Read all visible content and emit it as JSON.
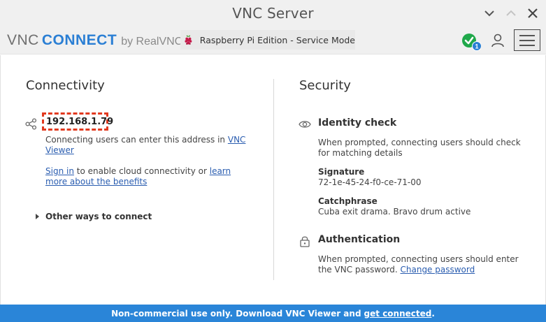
{
  "window": {
    "title": "VNC Server"
  },
  "header": {
    "logo_vnc": "VNC",
    "logo_connect": "CONNECT",
    "logo_by": "by RealVNC",
    "edition": "Raspberry Pi Edition - Service Mode",
    "status_badge_count": "1"
  },
  "connectivity": {
    "title": "Connectivity",
    "ip_address": "192.168.1.79",
    "address_text": "Connecting users can enter this address in ",
    "vnc_viewer_link": "VNC Viewer",
    "signin_link": "Sign in",
    "signin_text": " to enable cloud connectivity or ",
    "learn_more_link": "learn more about the benefits",
    "other_ways": "Other ways to connect"
  },
  "security": {
    "title": "Security",
    "identity_check": {
      "title": "Identity check",
      "description": "When prompted, connecting users should check for matching details",
      "signature_label": "Signature",
      "signature_value": "72-1e-45-24-f0-ce-71-00",
      "catchphrase_label": "Catchphrase",
      "catchphrase_value": "Cuba exit drama. Bravo drum active"
    },
    "authentication": {
      "title": "Authentication",
      "description": "When prompted, connecting users should enter the VNC password. ",
      "change_password_link": "Change password"
    }
  },
  "footer": {
    "text": "Non-commercial use only. Download VNC Viewer and",
    "link": "get connected",
    "suffix": "."
  },
  "colors": {
    "accent_blue": "#2a85d8",
    "link_blue": "#2a5db0",
    "highlight_red": "#e2391f",
    "status_green": "#1fa84a",
    "badge_blue": "#2a7fd4"
  }
}
